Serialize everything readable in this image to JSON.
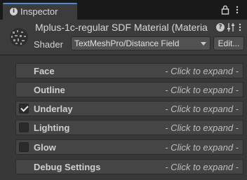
{
  "tab": {
    "title": "Inspector",
    "icon": "info-icon"
  },
  "header": {
    "title": "Mplus-1c-regular SDF Material (Materia",
    "shader_label": "Shader",
    "shader_value": "TextMeshPro/Distance Field",
    "edit_label": "Edit..."
  },
  "sections": [
    {
      "label": "Face",
      "hint": "- Click to expand -",
      "has_toggle": false
    },
    {
      "label": "Outline",
      "hint": "- Click to expand -",
      "has_toggle": false
    },
    {
      "label": "Underlay",
      "hint": "- Click to expand -",
      "has_toggle": true,
      "checked": true
    },
    {
      "label": "Lighting",
      "hint": "- Click to expand -",
      "has_toggle": true,
      "checked": false
    },
    {
      "label": "Glow",
      "hint": "- Click to expand -",
      "has_toggle": true,
      "checked": false
    },
    {
      "label": "Debug Settings",
      "hint": "- Click to expand -",
      "has_toggle": false
    }
  ],
  "colors": {
    "accent": "#4d8ad9",
    "panel": "#383838",
    "section": "#454545"
  }
}
